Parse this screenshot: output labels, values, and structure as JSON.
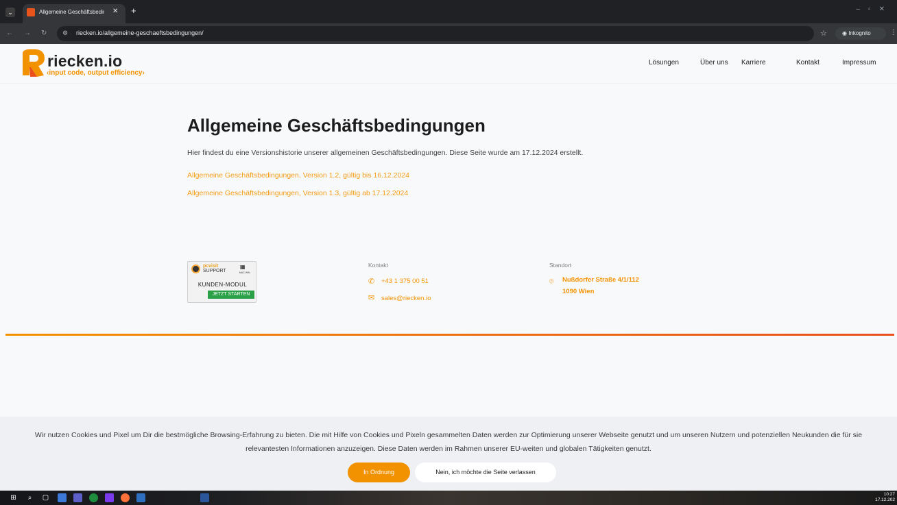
{
  "browser": {
    "tab_title": "Allgemeine Geschäftsbedingun",
    "url": "riecken.io/allgemeine-geschaeftsbedingungen/",
    "incognito_label": "Inkognito"
  },
  "site": {
    "logo_name": "riecken.io",
    "logo_tagline": "‹input code, output efficiency›",
    "nav": [
      "Lösungen",
      "Über uns",
      "Karriere",
      "Kontakt",
      "Impressum"
    ]
  },
  "main": {
    "title": "Allgemeine Geschäftsbedingungen",
    "intro": "Hier findest du eine Versionshistorie unserer allgemeinen Geschäftsbedingungen. Diese Seite wurde am 17.12.2024 erstellt.",
    "links": [
      "Allgemeine Geschäftsbedingungen, Version 1.2, gültig bis 16.12.2024",
      "Allgemeine Geschäftsbedingungen, Version 1.3, gültig ab 17.12.2024"
    ]
  },
  "footer": {
    "pcvisit": {
      "brand": "pcvisit",
      "support": "SUPPORT",
      "os": "MAC WIN",
      "module": "KUNDEN-MODUL",
      "button": "JETZT STARTEN"
    },
    "contact_heading": "Kontakt",
    "phone": "+43 1 375 00 51",
    "email": "sales@riecken.io",
    "location_heading": "Standort",
    "address_line1": "Nußdorfer Straße 4/1/112",
    "address_line2": "1090 Wien"
  },
  "cookie": {
    "text": "Wir nutzen Cookies und Pixel um Dir die bestmögliche Browsing-Erfahrung zu bieten. Die mit Hilfe von Cookies und Pixeln gesammelten Daten werden zur Optimierung unserer Webseite genutzt und um unseren Nutzern und potenziellen Neukunden die für sie relevantesten Informationen anzuzeigen. Diese Daten werden im Rahmen unserer EU-weiten und globalen Tätigkeiten genutzt.",
    "accept": "In Ordnung",
    "decline": "Nein, ich möchte die Seite verlassen"
  },
  "taskbar": {
    "time": "10:27",
    "date": "17.12.202"
  },
  "colors": {
    "accent": "#f39200",
    "accent_dark": "#ea4f1c"
  }
}
